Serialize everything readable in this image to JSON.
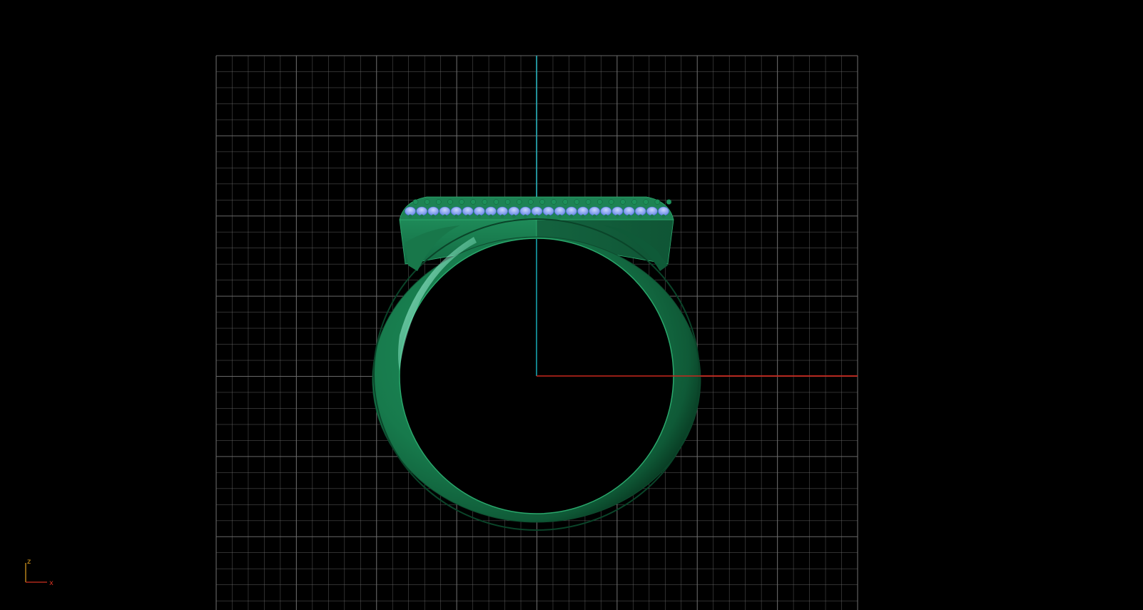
{
  "viewport": {
    "background": "#000000",
    "view": "front"
  },
  "grid": {
    "line_color": "#6e6e6e",
    "major_divisions": 8,
    "minor_per_major": 5
  },
  "axes": {
    "x_color": "#c8281e",
    "z_color": "#1ab8c4"
  },
  "model": {
    "type": "ring",
    "body_color": "#1a7a4f",
    "highlight_color": "#9fffe0",
    "gem_color": "#8aa8ff",
    "gem_count_per_row": 23
  },
  "gizmo": {
    "z_label": "z",
    "x_label": "x",
    "z_color": "#e0a020",
    "x_color": "#d03020"
  }
}
